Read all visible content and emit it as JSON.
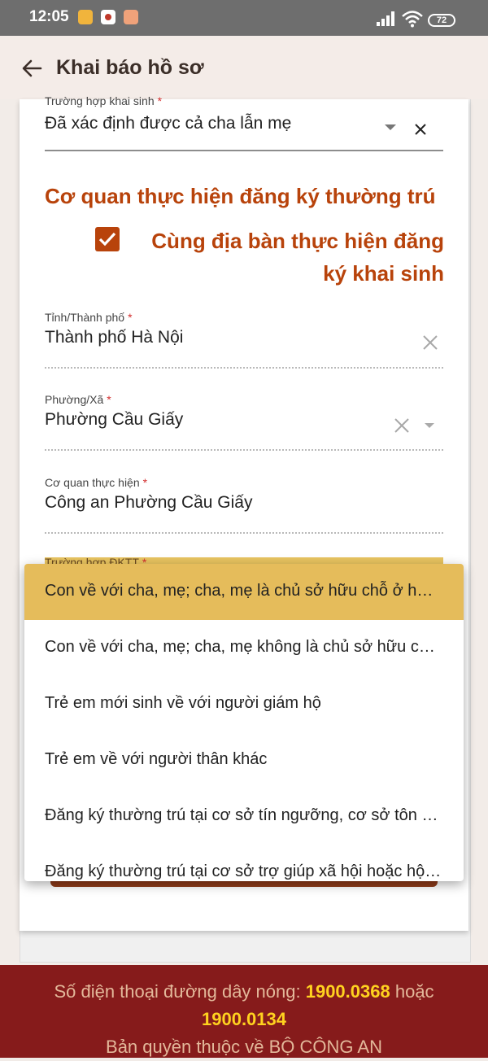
{
  "status_bar": {
    "time": "12:05",
    "battery": "72"
  },
  "app_bar": {
    "back_icon": "arrow-left-icon",
    "title": "Khai báo hồ sơ"
  },
  "form": {
    "birth_case": {
      "label": "Trường hợp khai sinh",
      "value": "Đã xác định được cả cha lẫn mẹ"
    },
    "section_title": "Cơ quan thực hiện đăng ký thường trú",
    "same_area_checkbox": {
      "label": "Cùng địa bàn thực hiện đăng ký khai sinh",
      "checked": true
    },
    "province": {
      "label": "Tỉnh/Thành phố",
      "value": "Thành phố Hà Nội"
    },
    "ward": {
      "label": "Phường/Xã",
      "value": "Phường Cầu Giấy"
    },
    "agency": {
      "label": "Cơ quan thực hiện",
      "value": "Công an Phường Cầu Giấy"
    },
    "residence_case": {
      "label": "Trường hợp ĐKTT"
    },
    "required_mark": "*"
  },
  "dropdown": {
    "options": [
      "Con về với cha, mẹ; cha, mẹ là chủ sở hữu chỗ ở hợp pháp",
      "Con về với cha, mẹ; cha, mẹ không là chủ sở hữu chỗ ở hợp pháp",
      "Trẻ em mới sinh về với người giám hộ",
      "Trẻ em về với người thân khác",
      "Đăng ký thường trú tại cơ sở tín ngưỡng, cơ sở tôn giáo",
      "Đăng ký thường trú tại cơ sở trợ giúp xã hội hoặc hộ gia đình nhận chăm sóc"
    ],
    "selected_index": 0
  },
  "footer": {
    "hotline_prefix": "Số điện thoại đường dây nóng:",
    "hotline_1": "1900.0368",
    "hotline_or": "hoặc",
    "hotline_2": "1900.0134",
    "copyright": "Bản quyền thuộc về BỘ CÔNG AN"
  },
  "colors": {
    "accent": "#b8430b",
    "selected_option": "#e5bc5b",
    "footer_bg": "#861b1b",
    "footer_highlight": "#ffd21f"
  }
}
